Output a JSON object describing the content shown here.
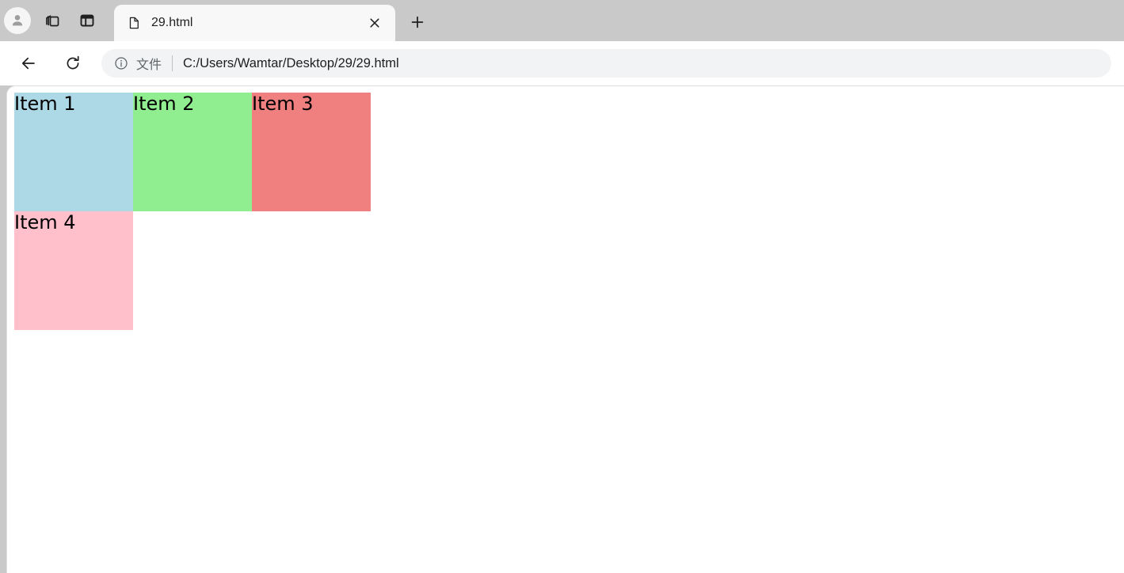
{
  "browser": {
    "tabstrip": {
      "avatar_icon": "profile-avatar-icon",
      "tab_groups_icon": "tab-stack-icon",
      "split_view_icon": "split-panel-icon",
      "new_tab_label": "+",
      "tabs": [
        {
          "title": "29.html",
          "favicon": "page-document-icon",
          "close_label": "×",
          "active": true
        }
      ]
    },
    "toolbar": {
      "back_icon": "back-arrow-icon",
      "reload_icon": "reload-icon",
      "omnibox": {
        "info_icon": "info-circle-icon",
        "scheme_label": "文件",
        "separator": "|",
        "url": "C:/Users/Wamtar/Desktop/29/29.html"
      }
    }
  },
  "page": {
    "items": [
      {
        "label": "Item 1",
        "color": "#add8e6"
      },
      {
        "label": "Item 2",
        "color": "#90ee90"
      },
      {
        "label": "Item 3",
        "color": "#f08080"
      },
      {
        "label": "Item 4",
        "color": "#ffc0cb"
      }
    ]
  },
  "colors": {
    "chrome_bg": "#c9c9c9",
    "tab_active_bg": "#f8f8f8",
    "toolbar_bg": "#ffffff",
    "omnibox_bg": "#f1f3f4",
    "page_bg": "#ffffff"
  }
}
